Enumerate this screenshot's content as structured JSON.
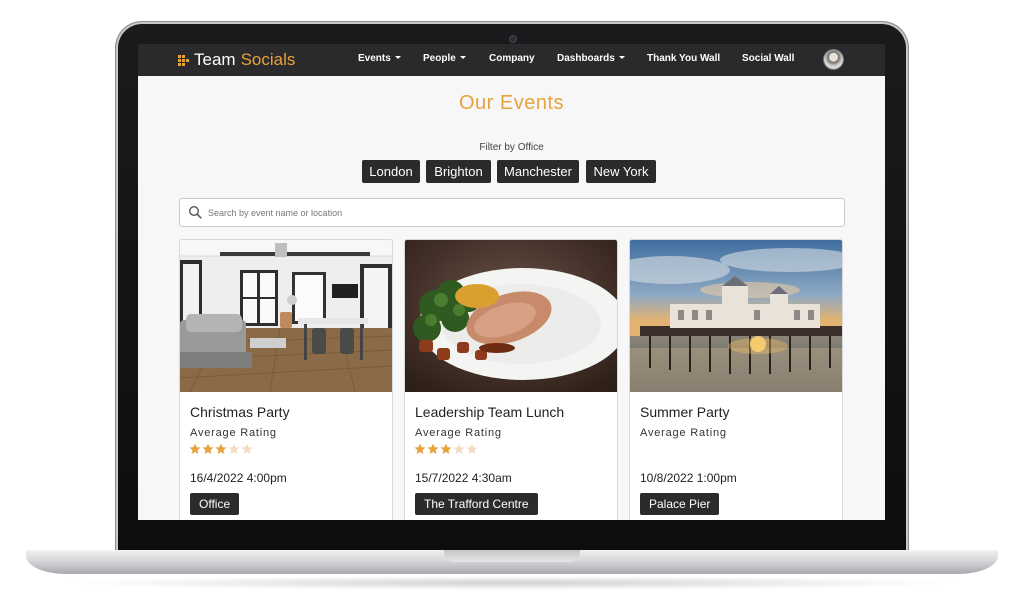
{
  "app": {
    "brand_name": "Team",
    "brand_accent": "Socials",
    "accent_color": "#e7a23a"
  },
  "nav": {
    "items": [
      {
        "label": "Events",
        "dropdown": true
      },
      {
        "label": "People",
        "dropdown": true
      },
      {
        "label": "Company",
        "dropdown": false
      },
      {
        "label": "Dashboards",
        "dropdown": true
      },
      {
        "label": "Thank You Wall",
        "dropdown": false
      },
      {
        "label": "Social Wall",
        "dropdown": false
      }
    ],
    "avatar_icon": "user-avatar"
  },
  "page": {
    "title": "Our Events"
  },
  "filter": {
    "label": "Filter by Office",
    "offices": [
      "London",
      "Brighton",
      "Manchester",
      "New York"
    ]
  },
  "search": {
    "placeholder": "Search by event name or location",
    "value": ""
  },
  "events": [
    {
      "title": "Christmas Party",
      "rating_label": "Average Rating",
      "rating": 3,
      "rating_max": 5,
      "date": "16/4/2022 4:00pm",
      "location": "Office",
      "image": "office-interior-photo"
    },
    {
      "title": "Leadership Team Lunch",
      "rating_label": "Average Rating",
      "rating": 3,
      "rating_max": 5,
      "date": "15/7/2022 4:30am",
      "location": "The Trafford Centre",
      "image": "plated-meal-photo"
    },
    {
      "title": "Summer Party",
      "rating_label": "Average Rating",
      "rating": 0,
      "rating_max": 0,
      "date": "10/8/2022 1:00pm",
      "location": "Palace Pier",
      "image": "pier-sunset-photo"
    }
  ]
}
